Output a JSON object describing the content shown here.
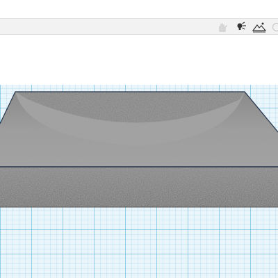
{
  "toolbar": {
    "buttons": [
      {
        "icon": "hand-icon",
        "state": "disabled"
      },
      {
        "icon": "light-bulb-icon",
        "state": "enabled"
      },
      {
        "icon": "terrain-icon",
        "state": "enabled"
      },
      {
        "icon": "circle-icon",
        "state": "disabled"
      }
    ]
  },
  "viewport": {
    "grid_color": "#6fc3e4",
    "grid_major_color": "#3aa7d4",
    "plane_color": "#e9f4fa",
    "object_color": "#9a9a9a",
    "selection_outline_color": "#24324a"
  }
}
